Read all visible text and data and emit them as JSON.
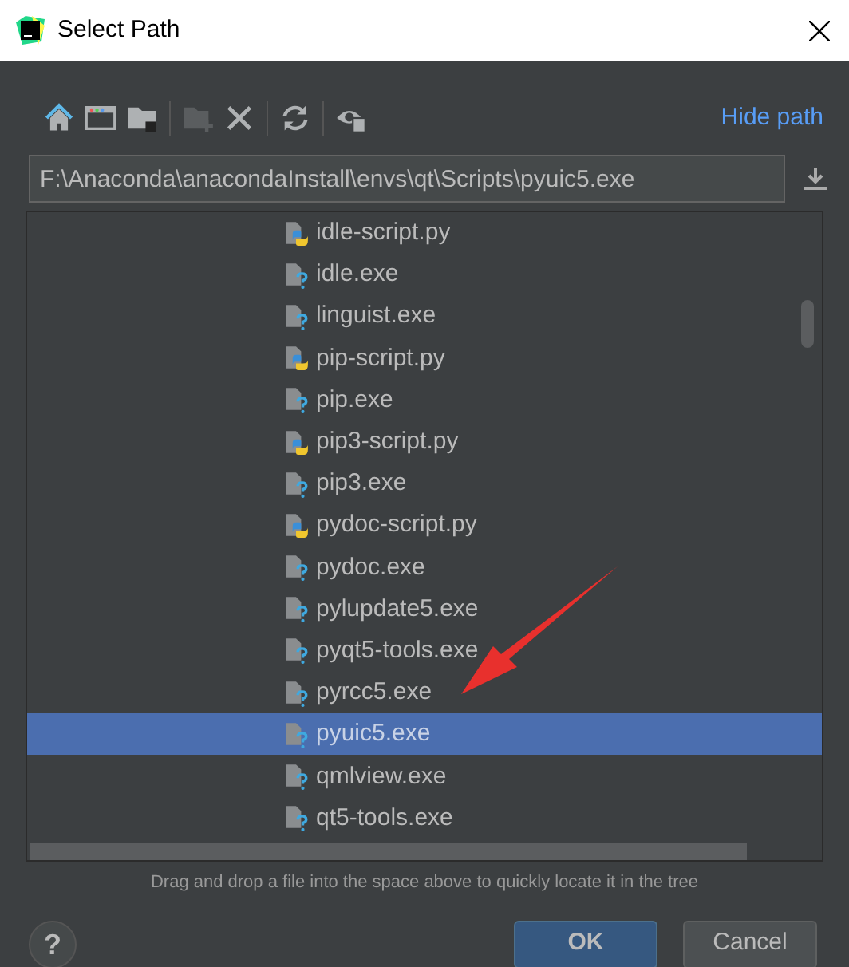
{
  "window": {
    "title": "Select Path"
  },
  "toolbar": [
    {
      "kind": "home",
      "disabled": false
    },
    {
      "kind": "window",
      "disabled": false
    },
    {
      "kind": "folder",
      "disabled": false
    },
    {
      "kind": "newfolder",
      "disabled": true
    },
    {
      "kind": "close",
      "disabled": false
    },
    {
      "kind": "refresh",
      "disabled": false
    },
    {
      "kind": "eye",
      "disabled": false
    }
  ],
  "hide_path_link": "Hide path",
  "path_field": {
    "value": "F:\\Anaconda\\anacondaInstall\\envs\\qt\\Scripts\\pyuic5.exe"
  },
  "tree": [
    {
      "name": "idle-script.py",
      "kind": "python",
      "selected": false
    },
    {
      "name": "idle.exe",
      "kind": "unknown",
      "selected": false
    },
    {
      "name": "linguist.exe",
      "kind": "unknown",
      "selected": false
    },
    {
      "name": "pip-script.py",
      "kind": "python",
      "selected": false
    },
    {
      "name": "pip.exe",
      "kind": "unknown",
      "selected": false
    },
    {
      "name": "pip3-script.py",
      "kind": "python",
      "selected": false
    },
    {
      "name": "pip3.exe",
      "kind": "unknown",
      "selected": false
    },
    {
      "name": "pydoc-script.py",
      "kind": "python",
      "selected": false
    },
    {
      "name": "pydoc.exe",
      "kind": "unknown",
      "selected": false
    },
    {
      "name": "pylupdate5.exe",
      "kind": "unknown",
      "selected": false
    },
    {
      "name": "pyqt5-tools.exe",
      "kind": "unknown",
      "selected": false
    },
    {
      "name": "pyrcc5.exe",
      "kind": "unknown",
      "selected": false
    },
    {
      "name": "pyuic5.exe",
      "kind": "unknown",
      "selected": true
    },
    {
      "name": "qmlview.exe",
      "kind": "unknown",
      "selected": false
    },
    {
      "name": "qt5-tools.exe",
      "kind": "unknown",
      "selected": false
    }
  ],
  "hint": "Drag and drop a file into the space above to quickly locate it in the tree",
  "help_button": "?",
  "buttons": [
    {
      "label": "OK",
      "kind": "default"
    },
    {
      "label": "Cancel",
      "kind": "normal"
    }
  ]
}
